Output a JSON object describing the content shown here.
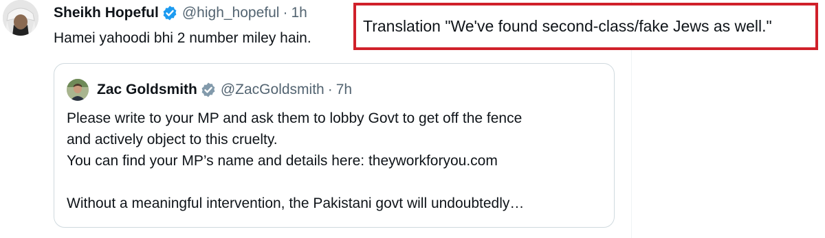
{
  "tweet": {
    "author_name": "Sheikh Hopeful",
    "handle": "@high_hopeful",
    "separator": "·",
    "time": "1h",
    "text": "Hamei yahoodi bhi 2 number miley hain."
  },
  "annotation": {
    "text": "Translation \"We've found second-class/fake Jews as well.\"",
    "border_color": "#d0202a"
  },
  "quoted_tweet": {
    "author_name": "Zac Goldsmith",
    "handle": "@ZacGoldsmith",
    "separator": "·",
    "time": "7h",
    "lines": [
      "Please write to your MP and ask them to lobby Govt to get off the fence",
      "and actively object to this cruelty.",
      "You can find your MP’s name and details here: theyworkforyou.com",
      "",
      "Without a meaningful intervention, the Pakistani govt will undoubtedly…"
    ]
  },
  "icons": {
    "verified": "verified-badge-icon"
  },
  "colors": {
    "verified_blue": "#1d9bf0",
    "secondary_text": "#536471",
    "primary_text": "#0f1419"
  }
}
